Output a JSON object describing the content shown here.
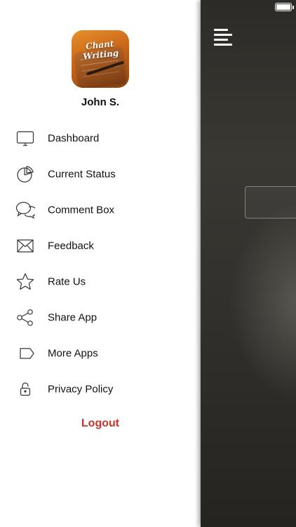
{
  "app": {
    "logo_text": "Chant Writing"
  },
  "user": {
    "name": "John S."
  },
  "menu": {
    "items": [
      {
        "label": "Dashboard",
        "icon": "monitor-icon"
      },
      {
        "label": "Current Status",
        "icon": "pie-chart-icon"
      },
      {
        "label": "Comment Box",
        "icon": "chat-bubbles-icon"
      },
      {
        "label": "Feedback",
        "icon": "envelope-icon"
      },
      {
        "label": "Rate Us",
        "icon": "star-icon"
      },
      {
        "label": "Share App",
        "icon": "share-icon"
      },
      {
        "label": "More Apps",
        "icon": "tag-icon"
      },
      {
        "label": "Privacy Policy",
        "icon": "lock-icon"
      }
    ],
    "logout_label": "Logout"
  },
  "colors": {
    "logout": "#c9342b",
    "drawer_bg": "#ffffff",
    "main_bg": "#33312d"
  },
  "main": {
    "menu_icon": "hamburger-menu-icon"
  }
}
